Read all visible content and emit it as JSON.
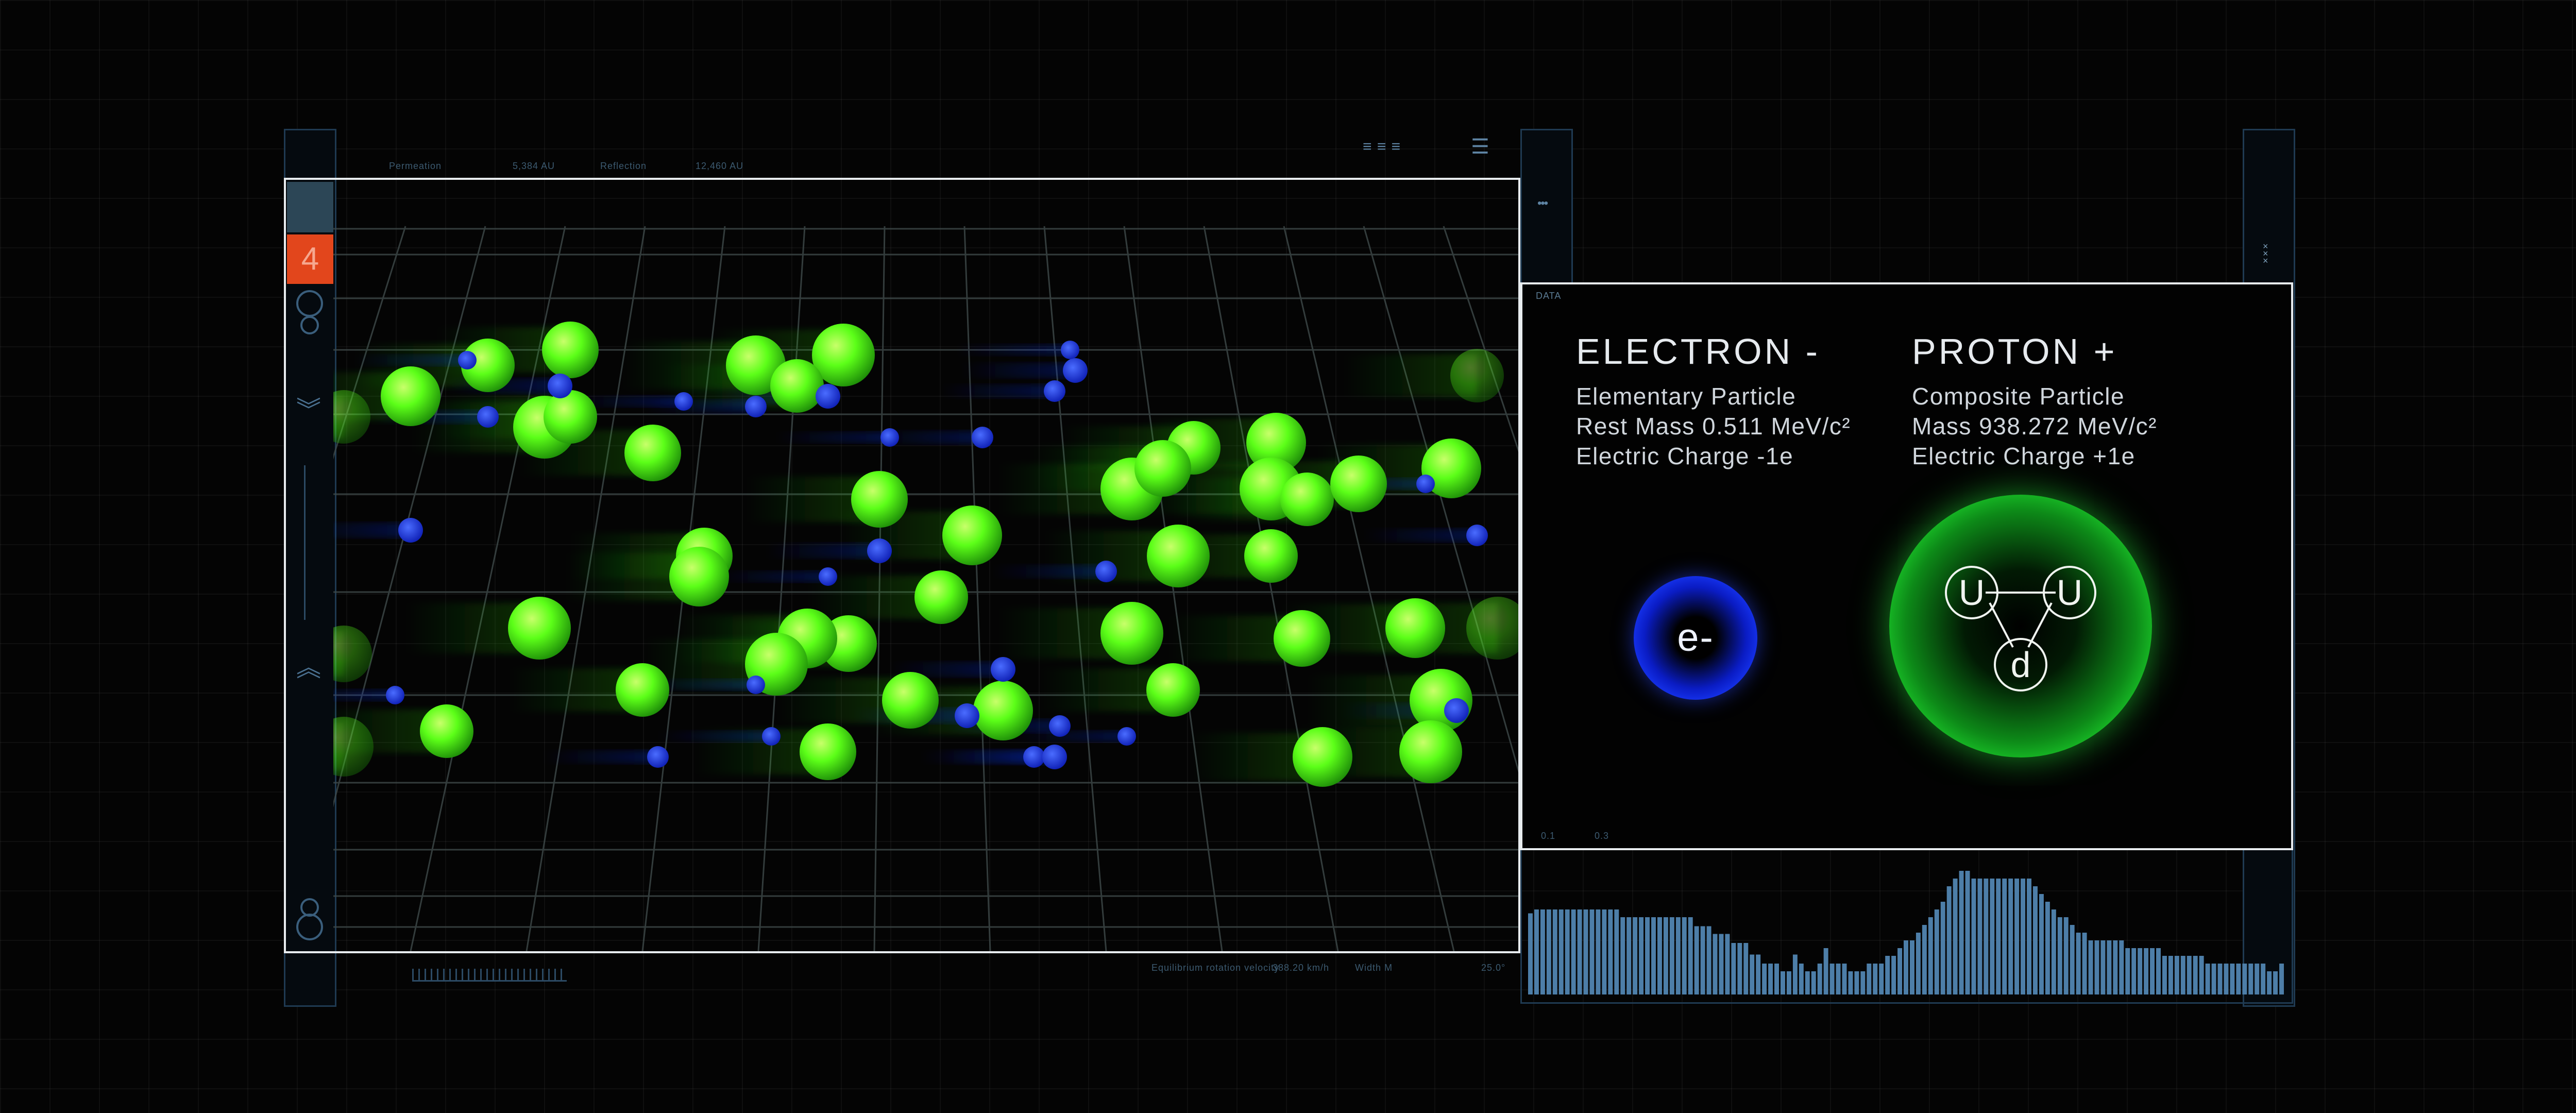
{
  "header": {
    "labels": [
      "Permeation",
      "5,384 AU",
      "Reflection",
      "12,460 AU"
    ],
    "right_glyphs": "≡ ≡ ≡",
    "stack_glyph": "☰"
  },
  "left_rail": {
    "counter": "4"
  },
  "footer": {
    "labels": [
      "Equilibrium rotation velocity",
      "388.20 km/h",
      "Width M",
      "25.0°"
    ]
  },
  "info": {
    "section_label": "DATA",
    "corner_ticks": [
      "0.1",
      "0.3"
    ],
    "electron": {
      "title": "ELECTRON -",
      "lines": [
        "Elementary Particle",
        "Rest Mass 0.511 MeV/c²",
        "Electric Charge -1e"
      ],
      "symbol": "e-",
      "color": "#1533e8"
    },
    "proton": {
      "title": "PROTON +",
      "lines": [
        "Composite Particle",
        "Mass 938.272 MeV/c²",
        "Electric Charge +1e"
      ],
      "quarks": [
        "U",
        "U",
        "d"
      ],
      "color": "#22ee33"
    }
  },
  "mid_rail": {
    "dots": "•••"
  },
  "colors": {
    "green": "#55ff1e",
    "blue": "#1430ff",
    "rail_accent": "#e2461c",
    "hist_bar": "#4d7ea8"
  },
  "histogram": {
    "values": [
      0.63,
      0.66,
      0.66,
      0.66,
      0.66,
      0.66,
      0.66,
      0.66,
      0.66,
      0.66,
      0.66,
      0.66,
      0.66,
      0.66,
      0.66,
      0.6,
      0.6,
      0.6,
      0.6,
      0.6,
      0.6,
      0.6,
      0.6,
      0.6,
      0.6,
      0.6,
      0.6,
      0.53,
      0.53,
      0.53,
      0.47,
      0.47,
      0.47,
      0.4,
      0.4,
      0.4,
      0.31,
      0.31,
      0.24,
      0.24,
      0.24,
      0.18,
      0.18,
      0.31,
      0.24,
      0.18,
      0.18,
      0.24,
      0.36,
      0.24,
      0.24,
      0.24,
      0.18,
      0.18,
      0.18,
      0.24,
      0.24,
      0.24,
      0.3,
      0.3,
      0.36,
      0.42,
      0.42,
      0.48,
      0.54,
      0.6,
      0.66,
      0.72,
      0.84,
      0.9,
      0.96,
      0.96,
      0.9,
      0.9,
      0.9,
      0.9,
      0.9,
      0.9,
      0.9,
      0.9,
      0.9,
      0.9,
      0.84,
      0.78,
      0.72,
      0.66,
      0.6,
      0.6,
      0.54,
      0.48,
      0.48,
      0.42,
      0.42,
      0.42,
      0.42,
      0.42,
      0.42,
      0.36,
      0.36,
      0.36,
      0.36,
      0.36,
      0.36,
      0.3,
      0.3,
      0.3,
      0.3,
      0.3,
      0.3,
      0.3,
      0.24,
      0.24,
      0.24,
      0.24,
      0.24,
      0.24,
      0.24,
      0.24,
      0.24,
      0.24,
      0.18,
      0.18,
      0.24
    ]
  }
}
